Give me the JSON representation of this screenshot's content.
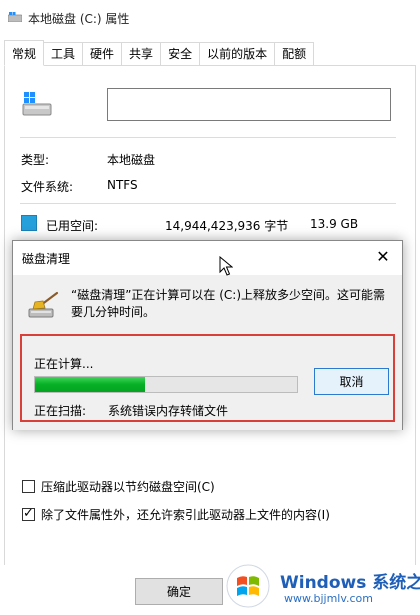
{
  "window": {
    "title": "本地磁盘 (C:) 属性"
  },
  "tabs": [
    {
      "label": "常规",
      "active": true
    },
    {
      "label": "工具"
    },
    {
      "label": "硬件"
    },
    {
      "label": "共享"
    },
    {
      "label": "安全"
    },
    {
      "label": "以前的版本"
    },
    {
      "label": "配额"
    }
  ],
  "general": {
    "name_value": "",
    "type_label": "类型:",
    "type_value": "本地磁盘",
    "fs_label": "文件系统:",
    "fs_value": "NTFS",
    "used_label": "已用空间:",
    "used_bytes": "14,944,423,936 字节",
    "used_gb": "13.9 GB",
    "used_color": "#26a0da"
  },
  "options": {
    "compress_label": "压缩此驱动器以节约磁盘空间(C)",
    "compress_checked": false,
    "index_label": "除了文件属性外，还允许索引此驱动器上文件的内容(I)",
    "index_checked": true
  },
  "ok_label": "确定",
  "dialog": {
    "title": "磁盘清理",
    "close_glyph": "✕",
    "message": "“磁盘清理”正在计算可以在 (C:)上释放多少空间。这可能需要几分钟时间。",
    "calculating_label": "正在计算...",
    "progress_fraction": 0.42,
    "cancel_label": "取消",
    "scanning_label": "正在扫描:",
    "scanning_value": "系统错误内存转储文件",
    "highlight_color": "#d9403a"
  },
  "watermark": {
    "title": "Windows",
    "title_suffix": "系统之家",
    "url": "www.bjjmlv.com"
  },
  "icons": {
    "title_icon": "drive-icon",
    "drive_icon": "drive-icon",
    "cleanup_icon": "broom-icon",
    "cursor": "mouse-cursor-icon",
    "watermark_logo": "windows-logo-icon"
  }
}
